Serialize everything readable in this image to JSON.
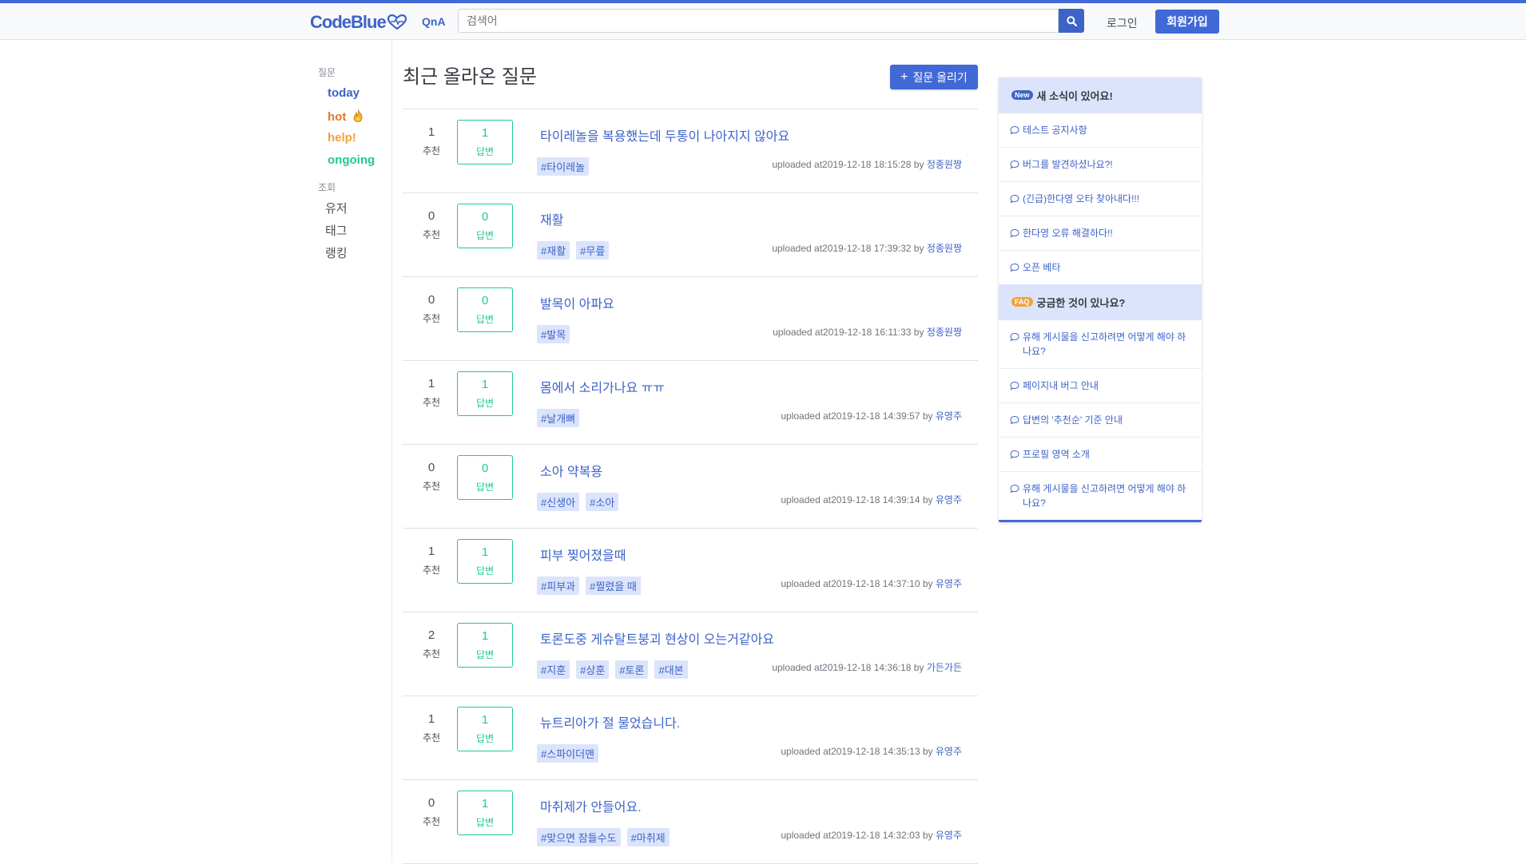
{
  "header": {
    "logo_text": "CodeBlue",
    "nav_qna": "QnA",
    "search_placeholder": "검색어",
    "login": "로그인",
    "signup": "회원가입"
  },
  "sidebar": {
    "section_questions": "질문",
    "items": [
      {
        "label": "today",
        "color": "#3d63c8"
      },
      {
        "label": "hot",
        "color": "#e8742f"
      },
      {
        "label": "help!",
        "color": "#f0a33a"
      },
      {
        "label": "ongoing",
        "color": "#20c997"
      }
    ],
    "section_browse": "조회",
    "browse": [
      "유저",
      "태그",
      "랭킹"
    ]
  },
  "main": {
    "title": "최근 올라온 질문",
    "ask_button": "질문 올리기",
    "vote_label": "추천",
    "answer_label": "답변",
    "questions": [
      {
        "votes": "1",
        "answers": "1",
        "title": "타이레놀을 복용했는데 두통이 나아지지 않아요",
        "tags": [
          "#타이레놀"
        ],
        "uploaded": "uploaded at2019-12-18 18:15:28 by",
        "author": "정종원짱"
      },
      {
        "votes": "0",
        "answers": "0",
        "title": "재활",
        "tags": [
          "#재활",
          "#무릎"
        ],
        "uploaded": "uploaded at2019-12-18 17:39:32 by",
        "author": "정종원짱"
      },
      {
        "votes": "0",
        "answers": "0",
        "title": "발목이 아파요",
        "tags": [
          "#발목"
        ],
        "uploaded": "uploaded at2019-12-18 16:11:33 by",
        "author": "정종원짱"
      },
      {
        "votes": "1",
        "answers": "1",
        "title": "몸에서 소리가나요 ㅠㅠ",
        "tags": [
          "#날개뼈"
        ],
        "uploaded": "uploaded at2019-12-18 14:39:57 by",
        "author": "유영주"
      },
      {
        "votes": "0",
        "answers": "0",
        "title": "소아 약복용",
        "tags": [
          "#신생아",
          "#소아"
        ],
        "uploaded": "uploaded at2019-12-18 14:39:14 by",
        "author": "유영주"
      },
      {
        "votes": "1",
        "answers": "1",
        "title": "피부 찢어졌을때",
        "tags": [
          "#피부과",
          "#찔렸을 때"
        ],
        "uploaded": "uploaded at2019-12-18 14:37:10 by",
        "author": "유영주"
      },
      {
        "votes": "2",
        "answers": "1",
        "title": "토론도중 게슈탈트붕괴 현상이 오는거같아요",
        "tags": [
          "#지훈",
          "#상훈",
          "#토론",
          "#대본"
        ],
        "uploaded": "uploaded at2019-12-18 14:36:18 by",
        "author": "가든가든"
      },
      {
        "votes": "1",
        "answers": "1",
        "title": "뉴트리아가 절 물었습니다.",
        "tags": [
          "#스파이더맨"
        ],
        "uploaded": "uploaded at2019-12-18 14:35:13 by",
        "author": "유영주"
      },
      {
        "votes": "0",
        "answers": "1",
        "title": "마취제가 안들어요.",
        "tags": [
          "#맞으면 잠들수도",
          "#마취제"
        ],
        "uploaded": "uploaded at2019-12-18 14:32:03 by",
        "author": "유영주"
      }
    ]
  },
  "notice": {
    "news_badge": "New",
    "news_title": "새 소식이 있어요!",
    "news_items": [
      "테스트 공지사항",
      "버그를 발견하셨나요?!",
      "(긴급)한다영 오타 찾아내다!!!",
      "한다영 오류 해결하다!!",
      "오픈 베타"
    ],
    "faq_badge": "FAQ",
    "faq_title": "궁금한 것이 있나요?",
    "faq_items": [
      "유해 게시물을 신고하려면 어떻게 해야 하나요?",
      "페이지내 버그 안내",
      "답변의 '추천순' 기준 안내",
      "프로필 영역 소개",
      "유해 게시물을 신고하려면 어떻게 해야 하나요?"
    ]
  },
  "colors": {
    "primary": "#4169d6",
    "link": "#3d63c8",
    "answer": "#20c997",
    "tag_bg": "#dbe4fb"
  }
}
